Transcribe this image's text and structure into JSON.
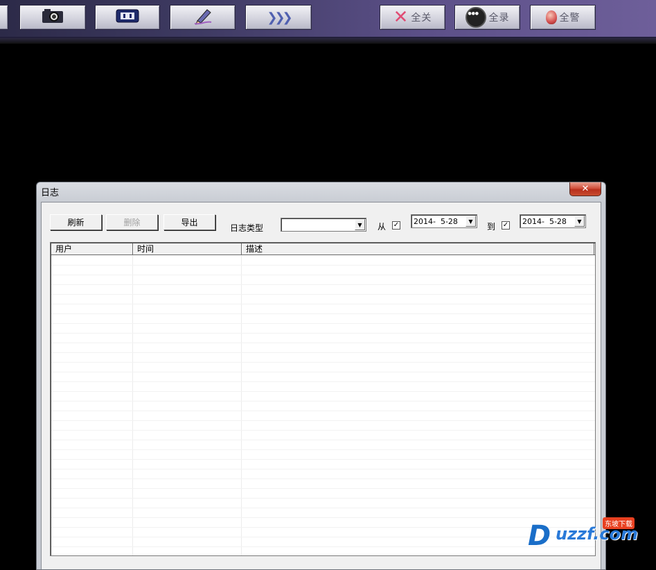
{
  "toolbar": {
    "buttons_left": [
      {
        "icon": "camera-icon"
      },
      {
        "icon": "video-record-icon"
      },
      {
        "icon": "pen-icon"
      },
      {
        "icon": "next-icon",
        "glyph": "❯❯❯"
      }
    ],
    "close_all_label": "全关",
    "record_all_label": "全录",
    "alarm_all_label": "全警",
    "accent_colors": {
      "close_all": "#e04c74",
      "alarm_all": "#d45050"
    }
  },
  "dialog": {
    "title": "日志",
    "close_glyph": "✕",
    "refresh_label": "刷新",
    "delete_label": "删除",
    "export_label": "导出",
    "log_type_label": "日志类型",
    "log_type_value": "",
    "from_label": "从",
    "from_checked": true,
    "from_date": "2014-  5-28",
    "to_label": "到",
    "to_checked": true,
    "to_date": "2014-  5-28",
    "columns": [
      "用户",
      "时间",
      "描述"
    ],
    "rows": []
  },
  "watermark": {
    "text": "uzzf.com",
    "tag": "东坡下载"
  }
}
